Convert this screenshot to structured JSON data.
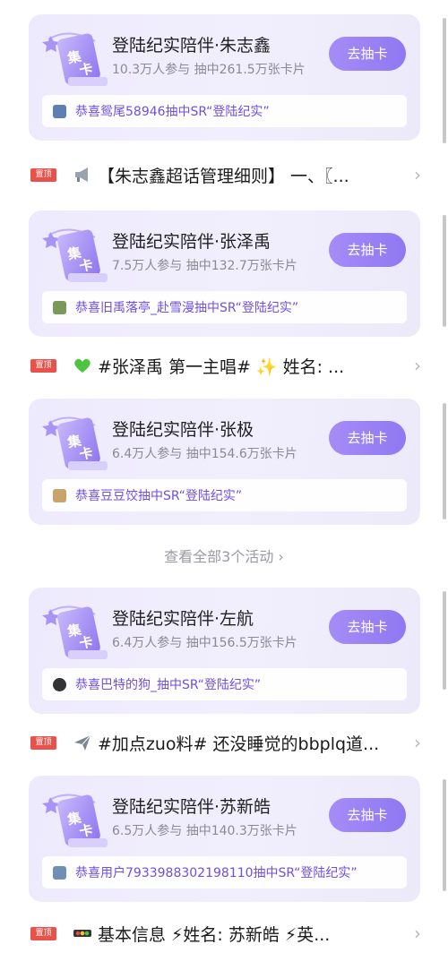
{
  "items": [
    {
      "card": {
        "title": "登陆纪实陪伴·朱志鑫",
        "meta": "10.3万人参与 抽中261.5万张卡片",
        "button": "去抽卡",
        "winner": "恭喜鸳尾58946抽中SR“登陆纪实”",
        "gift_text": "集卡"
      },
      "post": {
        "pin": "置顶",
        "text": "【朱志鑫超话管理细则】 一、〖...",
        "emoji": "megaphone-icon"
      }
    },
    {
      "card": {
        "title": "登陆纪实陪伴·张泽禹",
        "meta": "7.5万人参与 抽中132.7万张卡片",
        "button": "去抽卡",
        "winner": "恭喜旧禹落亭_赴雪漫抽中SR“登陆纪实”",
        "gift_text": "集卡"
      },
      "post": {
        "pin": "置顶",
        "text": "#张泽禹 第一主唱# ✨ 姓名: ...",
        "emoji": "green-heart-icon"
      }
    },
    {
      "card": {
        "title": "登陆纪实陪伴·张极",
        "meta": "6.4万人参与 抽中154.6万张卡片",
        "button": "去抽卡",
        "winner": "恭喜豆豆饺抽中SR“登陆纪实”",
        "gift_text": "集卡"
      }
    }
  ],
  "more_link": "查看全部3个活动 ›",
  "items2": [
    {
      "card": {
        "title": "登陆纪实陪伴·左航",
        "meta": "6.4万人参与 抽中156.5万张卡片",
        "button": "去抽卡",
        "winner": "恭喜巴特的狗_抽中SR“登陆纪实”",
        "gift_text": "集卡"
      },
      "post": {
        "pin": "置顶",
        "text": "#加点zuo料# 还没睡觉的bbplq道...",
        "emoji": "airplane-icon"
      }
    },
    {
      "card": {
        "title": "登陆纪实陪伴·苏新皓",
        "meta": "6.5万人参与 抽中140.3万张卡片",
        "button": "去抽卡",
        "winner": "恭喜用户7933988302198110抽中SR“登陆纪实”",
        "gift_text": "集卡"
      },
      "post": {
        "pin": "置顶",
        "text": "基本信息 ⚡姓名: 苏新皓 ⚡英...",
        "emoji": "traffic-light-icon"
      }
    }
  ],
  "colors": {
    "accent": "#8f78f2",
    "winner_text": "#6f4fe0",
    "pin_bg": "#e8524a"
  }
}
